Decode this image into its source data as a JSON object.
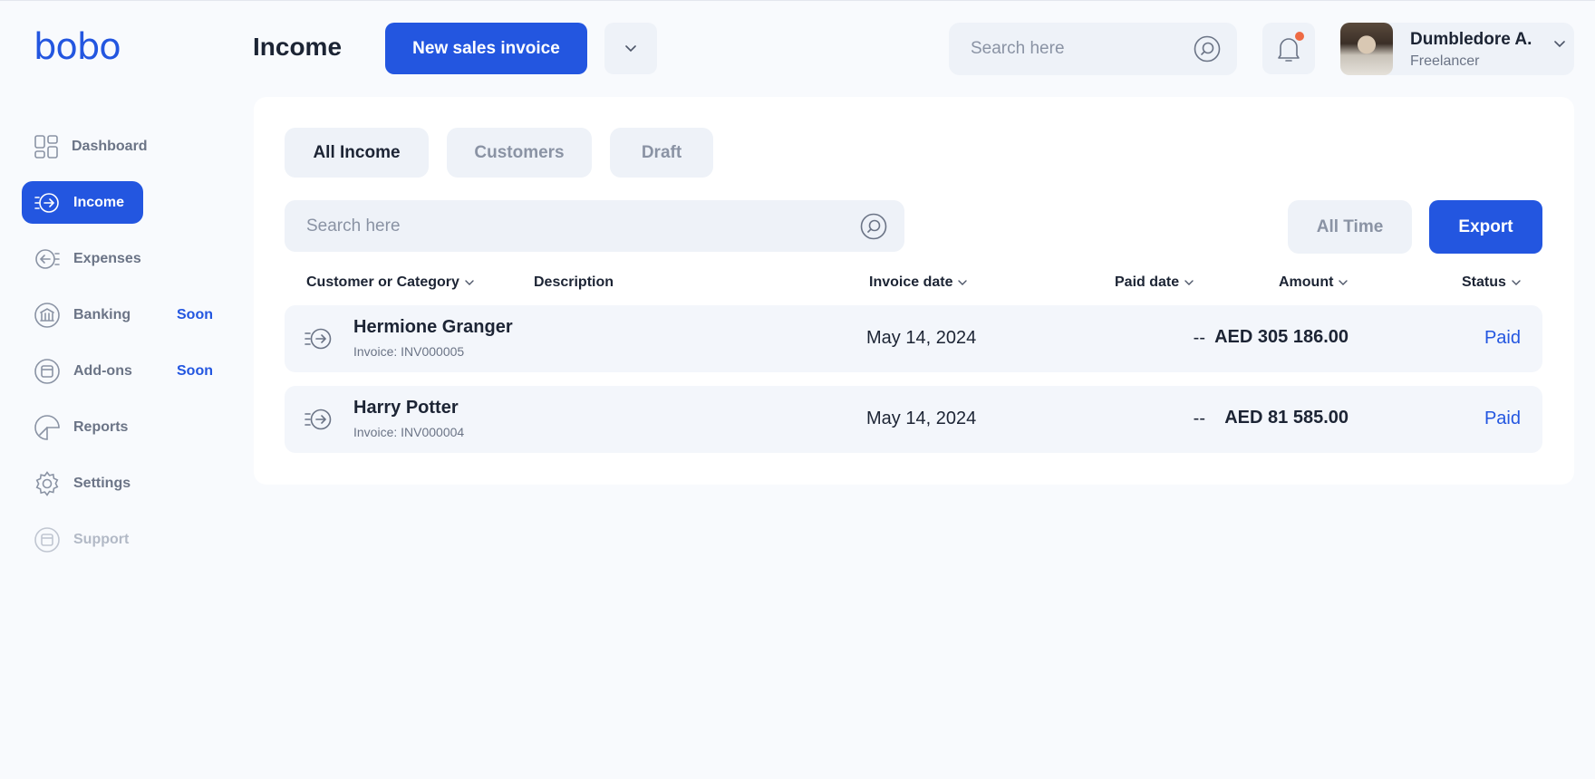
{
  "app": {
    "logo": "bobo"
  },
  "sidebar": {
    "items": [
      {
        "label": "Dashboard",
        "icon": "dashboard-icon"
      },
      {
        "label": "Income",
        "icon": "income-icon",
        "active": true
      },
      {
        "label": "Expenses",
        "icon": "expenses-icon"
      },
      {
        "label": "Banking",
        "icon": "bank-icon",
        "badge": "Soon"
      },
      {
        "label": "Add-ons",
        "icon": "addons-icon",
        "badge": "Soon"
      },
      {
        "label": "Reports",
        "icon": "reports-icon"
      },
      {
        "label": "Settings",
        "icon": "gear-icon"
      },
      {
        "label": "Support",
        "icon": "support-icon",
        "disabled": true
      }
    ]
  },
  "header": {
    "title": "Income",
    "new_invoice_label": "New sales invoice",
    "search_placeholder": "Search here",
    "user": {
      "name": "Dumbledore A.",
      "role": "Freelancer"
    }
  },
  "tabs": [
    {
      "label": "All Income",
      "active": true
    },
    {
      "label": "Customers"
    },
    {
      "label": "Draft"
    }
  ],
  "toolbar": {
    "search_placeholder": "Search here",
    "period_label": "All Time",
    "export_label": "Export"
  },
  "table": {
    "columns": [
      "Customer or Category",
      "Description",
      "Invoice date",
      "Paid date",
      "Amount",
      "Status"
    ],
    "rows": [
      {
        "name": "Hermione Granger",
        "invoice": "Invoice: INV000005",
        "description": "",
        "invoice_date": "May 14, 2024",
        "paid_date": "--",
        "amount": "AED 305 186.00",
        "status": "Paid"
      },
      {
        "name": "Harry Potter",
        "invoice": "Invoice: INV000004",
        "description": "",
        "invoice_date": "May 14, 2024",
        "paid_date": "--",
        "amount": "AED 81 585.00",
        "status": "Paid"
      }
    ]
  },
  "colors": {
    "accent": "#2356e0",
    "notification": "#ee6a44",
    "background": "#f8fafd"
  }
}
